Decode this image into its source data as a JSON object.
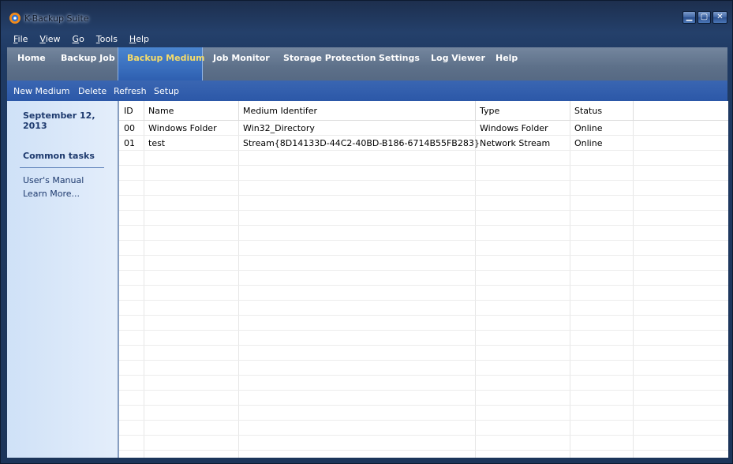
{
  "window": {
    "title": "K-Backup Suite",
    "buttons": {
      "minimize": "▁",
      "maximize": "▢",
      "close": "✕"
    }
  },
  "menu": [
    {
      "key": "F",
      "rest": "ile"
    },
    {
      "key": "V",
      "rest": "iew"
    },
    {
      "key": "G",
      "rest": "o"
    },
    {
      "key": "T",
      "rest": "ools"
    },
    {
      "key": "H",
      "rest": "elp"
    }
  ],
  "tabs": [
    "Home",
    "Backup Job",
    "Backup Medium",
    "Job Monitor",
    "Storage Protection",
    "Settings",
    "Log Viewer",
    "Help"
  ],
  "active_tab": "Backup Medium",
  "toolbar": {
    "new_medium": "New Medium",
    "delete": "Delete",
    "refresh": "Refresh",
    "setup": "Setup"
  },
  "sidebar": {
    "date": "September 12, 2013",
    "common_tasks": "Common tasks",
    "links": [
      "User's Manual",
      "Learn More..."
    ]
  },
  "table": {
    "columns": [
      "ID",
      "Name",
      "Medium Identifer",
      "Type",
      "Status"
    ],
    "rows": [
      {
        "id": "00",
        "name": "Windows Folder",
        "identifier": "Win32_Directory",
        "type": "Windows Folder",
        "status": "Online"
      },
      {
        "id": "01",
        "name": "test",
        "identifier": "Stream{8D14133D-44C2-40BD-B186-6714B55FB283}",
        "type": "Network Stream",
        "status": "Online"
      }
    ]
  },
  "colors": {
    "active_tab_text": "#f5dc6a",
    "active_tab_bg": "#3a6fbe",
    "toolbar_bg": "#2c58a8",
    "sidebar_bg": "#dce8f8"
  }
}
